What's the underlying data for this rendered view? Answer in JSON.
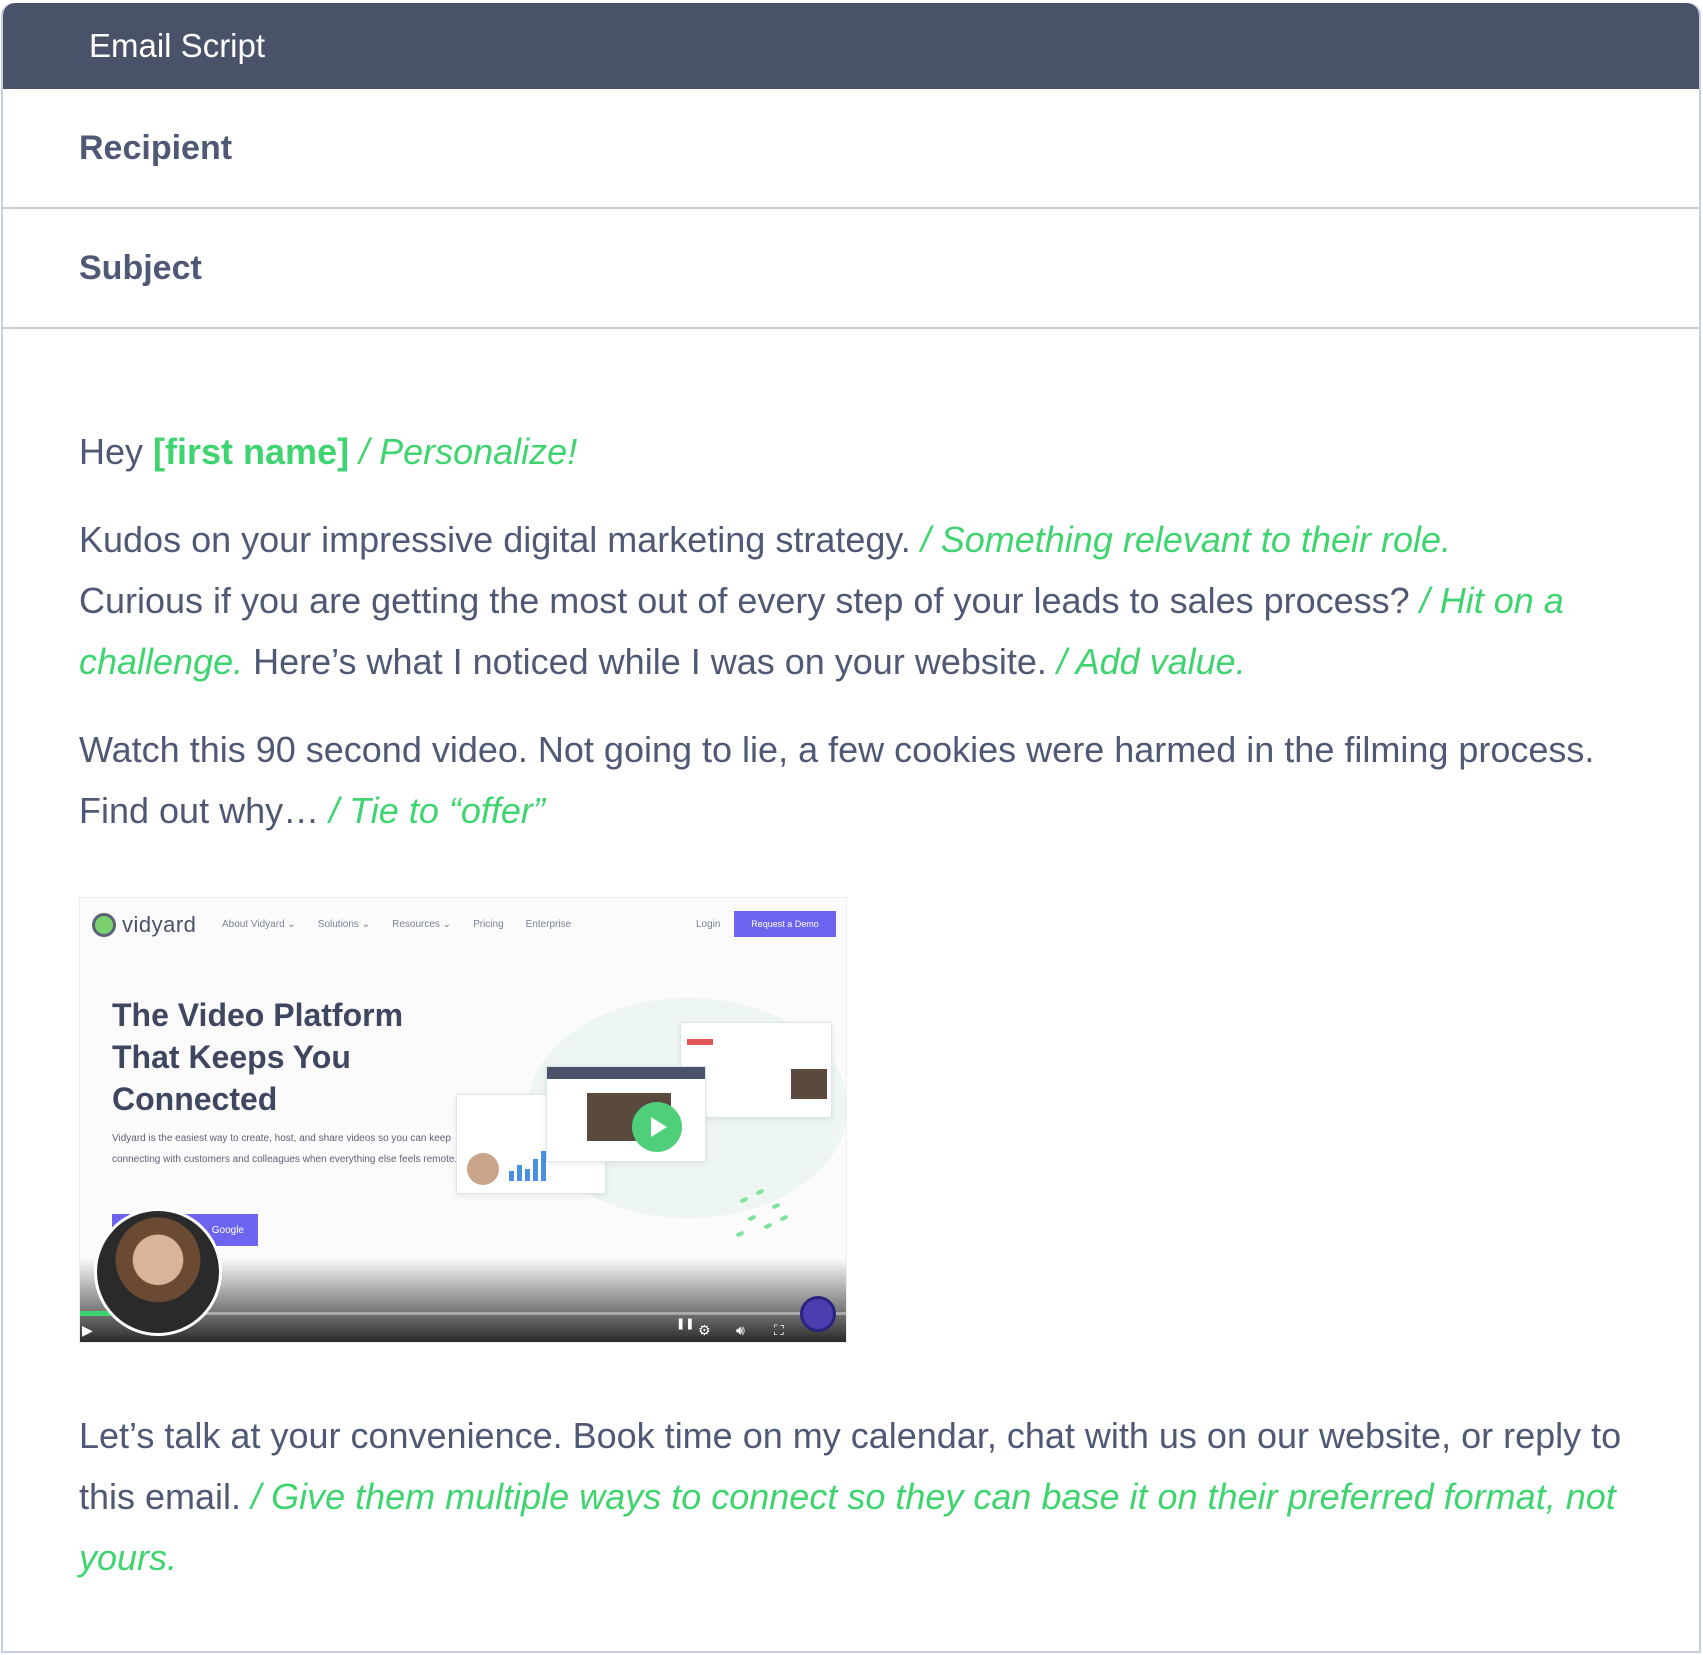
{
  "header": {
    "title": "Email Script"
  },
  "fields": {
    "recipient_label": "Recipient",
    "subject_label": "Subject"
  },
  "email": {
    "greeting": "Hey",
    "first_name_token": "[first name]",
    "greeting_note": "/ Personalize!",
    "p2_line1": "Kudos on your impressive digital marketing strategy.",
    "p2_note1": "/ Something relevant to their role.",
    "p2_line2": "Curious if you are getting the most out of every step of your leads to sales process?",
    "p2_note2": "/ Hit on a challenge.",
    "p2_line3": "Here’s what I noticed while I was on your website.",
    "p2_note3": "/ Add value.",
    "p3_text": "Watch this 90 second video. Not going to lie, a few cookies were harmed in the filming process. Find out why…",
    "p3_note": "/ Tie to “offer”",
    "p4_text": "Let’s talk at your convenience. Book time on my calendar, chat with us on our website, or reply to this email.",
    "p4_note": "/ Give them multiple ways to connect so they can base it on their preferred format, not yours."
  },
  "video": {
    "logo_text": "vidyard",
    "nav_items": [
      "About Vidyard ⌄",
      "Solutions ⌄",
      "Resources ⌄",
      "Pricing",
      "Enterprise"
    ],
    "login_label": "Login",
    "demo_label": "Request a Demo",
    "headline": "The Video Platform That Keeps You Connected",
    "subtext": "Vidyard is the easiest way to create, host, and share videos so you can keep connecting with customers and colleagues when everything else feels remote.",
    "cta_label": "Google",
    "progress": 0.09
  },
  "colors": {
    "header_bg": "#4a5269",
    "note_green": "#3fd470",
    "body_text": "#4f5874",
    "divider": "#c7cfdc",
    "vidyard_purple": "#6c63ef"
  },
  "icons": [
    "play-icon",
    "gear-icon",
    "volume-icon",
    "fullscreen-icon",
    "pause-icon"
  ]
}
